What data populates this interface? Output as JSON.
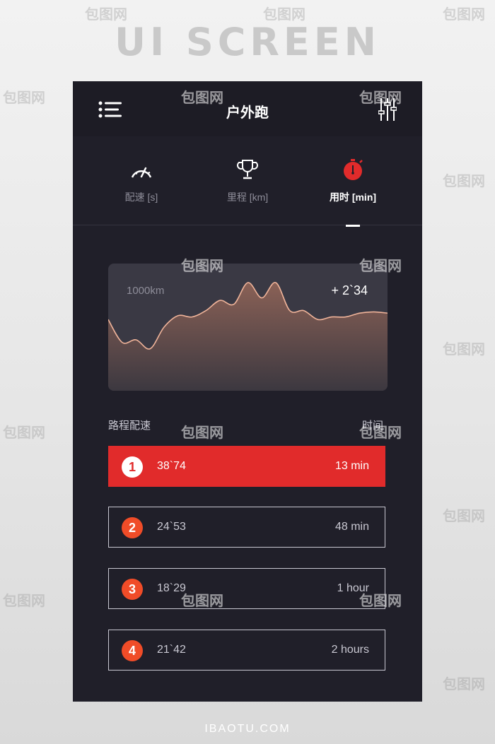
{
  "banner": {
    "title": "UI SCREEN"
  },
  "header": {
    "title": "户外跑"
  },
  "tabs": [
    {
      "label": "配速 [s]",
      "icon": "speedometer-icon",
      "active": false
    },
    {
      "label": "里程 [km]",
      "icon": "trophy-icon",
      "active": false
    },
    {
      "label": "用时 [min]",
      "icon": "stopwatch-icon",
      "active": true
    }
  ],
  "chart": {
    "label": "1000km",
    "delta": "+ 2`34"
  },
  "chart_data": {
    "type": "area",
    "x": [
      0,
      1,
      2,
      3,
      4,
      5,
      6,
      7,
      8,
      9,
      10,
      11,
      12,
      13,
      14,
      15,
      16,
      17,
      18,
      19,
      20
    ],
    "values": [
      56,
      38,
      40,
      33,
      50,
      59,
      58,
      63,
      71,
      68,
      85,
      73,
      85,
      63,
      63,
      56,
      58,
      58,
      61,
      62,
      61
    ],
    "ylim": [
      0,
      100
    ],
    "title": "",
    "xlabel": "",
    "ylabel": ""
  },
  "section": {
    "left_label": "路程配速",
    "right_label": "时间"
  },
  "records": [
    {
      "num": "1",
      "pace": "38`74",
      "duration": "13 min",
      "active": true
    },
    {
      "num": "2",
      "pace": "24`53",
      "duration": "48 min",
      "active": false
    },
    {
      "num": "3",
      "pace": "18`29",
      "duration": "1 hour",
      "active": false
    },
    {
      "num": "4",
      "pace": "21`42",
      "duration": "2 hours",
      "active": false
    }
  ],
  "watermark": {
    "text": "包图网"
  },
  "footer": {
    "text": "IBAOTU.COM"
  },
  "colors": {
    "accent": "#e12b2b",
    "badge": "#f04c28",
    "background": "#201f29",
    "card": "#3a3944"
  }
}
